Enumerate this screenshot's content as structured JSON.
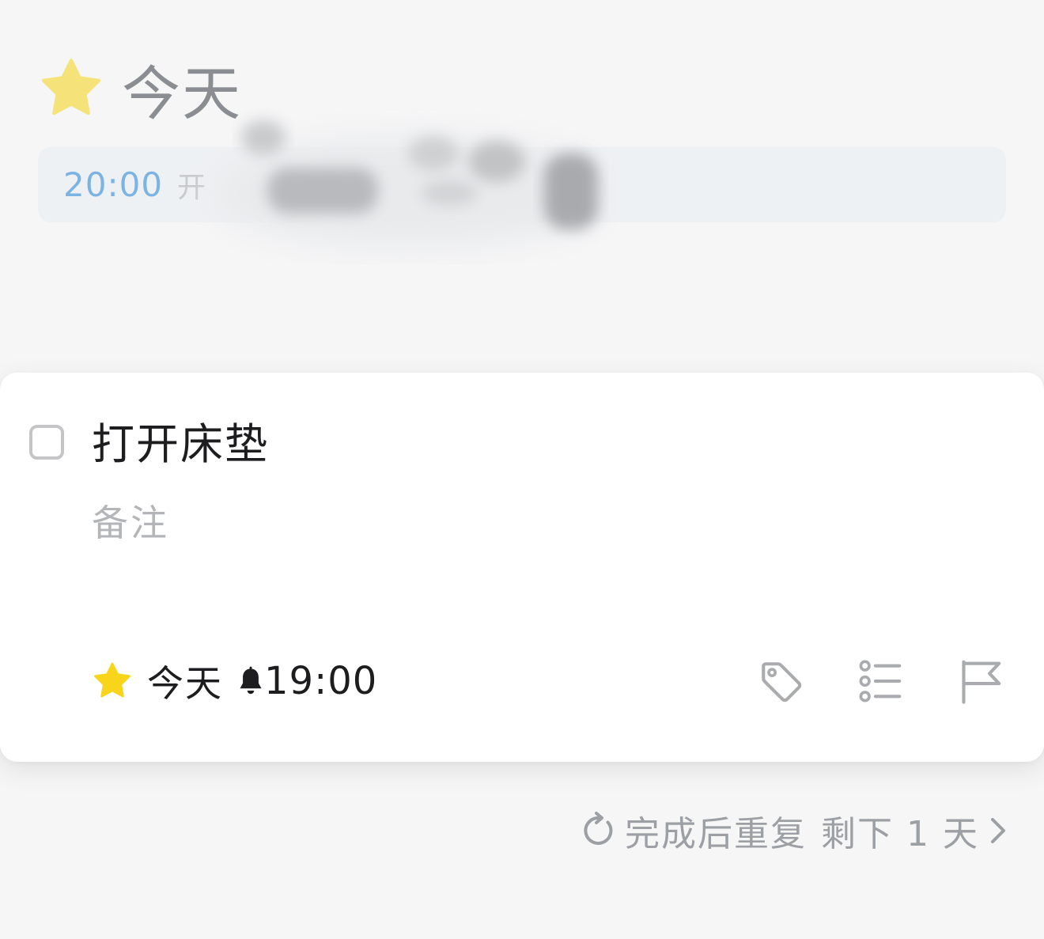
{
  "background_list": {
    "title": "今天",
    "icon": "star-icon",
    "row": {
      "time": "20:00",
      "text_fragment": "开"
    }
  },
  "task": {
    "title": "打开床垫",
    "notes_placeholder": "备注",
    "completed": false,
    "when_label": "今天",
    "reminder_icon": "bell-icon",
    "reminder_time": "19:00",
    "actions": [
      "tag-icon",
      "checklist-icon",
      "flag-icon"
    ]
  },
  "repeat": {
    "label": "完成后重复",
    "remaining": "剩下 1 天",
    "icon": "repeat-icon",
    "chevron": "chevron-right-icon"
  },
  "colors": {
    "background": "#f6f6f7",
    "card": "#ffffff",
    "star_dim": "#f5e37a",
    "star": "#f8d51b",
    "time_accent": "#7bb3e3",
    "muted_text": "#9c9fa3",
    "icon_gray": "#a9abae"
  }
}
